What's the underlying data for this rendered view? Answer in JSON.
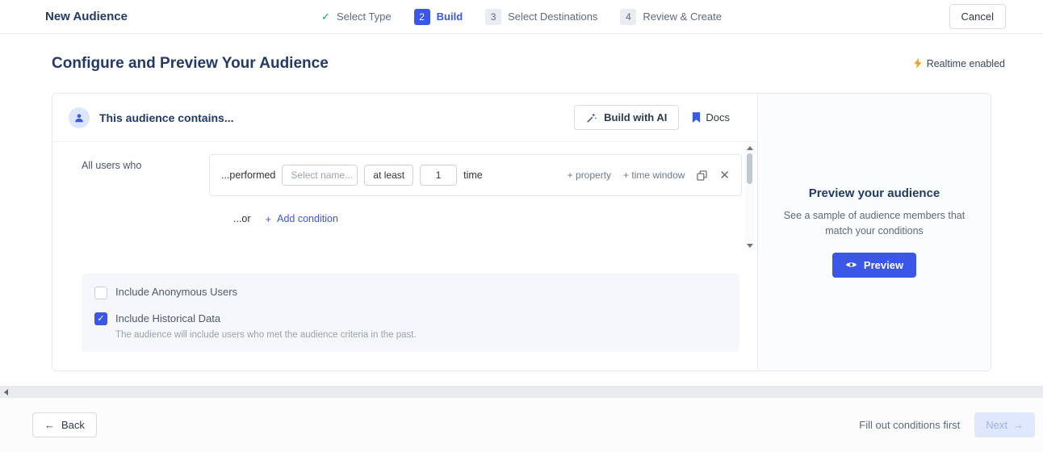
{
  "topbar": {
    "title": "New Audience",
    "cancel_label": "Cancel",
    "steps": [
      {
        "label": "Select Type",
        "state": "done"
      },
      {
        "num": "2",
        "label": "Build",
        "state": "active"
      },
      {
        "num": "3",
        "label": "Select Destinations",
        "state": "pending"
      },
      {
        "num": "4",
        "label": "Review & Create",
        "state": "pending"
      }
    ]
  },
  "page": {
    "heading": "Configure and Preview Your Audience",
    "realtime_badge": "Realtime enabled"
  },
  "builder": {
    "title": "This audience contains...",
    "build_with_ai_label": "Build with AI",
    "docs_label": "Docs",
    "all_users_label": "All users who",
    "condition": {
      "performed_label": "...performed",
      "event_name_placeholder": "Select name...",
      "operator_value": "at least",
      "count_value": "1",
      "unit_label": "time",
      "add_property_label": "+ property",
      "add_time_window_label": "+ time window"
    },
    "or_label": "...or",
    "add_condition_plus": "+",
    "add_condition_label": "Add condition",
    "options": {
      "anonymous": {
        "label": "Include Anonymous Users",
        "checked": false
      },
      "historical": {
        "label": "Include Historical Data",
        "checked": true,
        "description": "The audience will include users who met the audience criteria in the past."
      }
    }
  },
  "preview": {
    "title": "Preview your audience",
    "description": "See a sample of audience members that match your conditions",
    "button_label": "Preview"
  },
  "footer": {
    "back_label": "Back",
    "hint": "Fill out conditions first",
    "next_label": "Next"
  },
  "colors": {
    "accent_blue": "#3a57e8",
    "success_green": "#0ca678",
    "realtime_bolt_orange": "#f2a71b",
    "panel_gray": "#f6f7fa"
  }
}
